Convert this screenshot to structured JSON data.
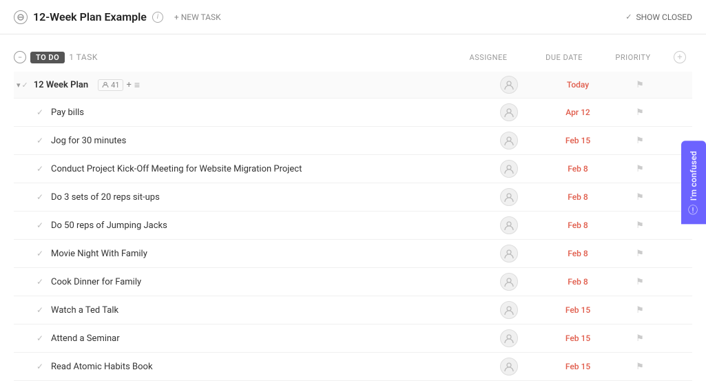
{
  "header": {
    "title": "12-Week Plan Example",
    "new_task_label": "+ NEW TASK",
    "show_closed_label": "SHOW CLOSED",
    "info_icon": "ⓘ"
  },
  "section": {
    "badge": "TO DO",
    "count_label": "1 TASK"
  },
  "columns": {
    "assignee": "ASSIGNEE",
    "due_date": "DUE DATE",
    "priority": "PRIORITY"
  },
  "parent_task": {
    "name": "12 Week Plan",
    "subtask_count": "41"
  },
  "tasks": [
    {
      "name": "Pay bills",
      "due": "Apr 12",
      "due_class": "due-red"
    },
    {
      "name": "Jog for 30 minutes",
      "due": "Feb 15",
      "due_class": "due-red"
    },
    {
      "name": "Conduct Project Kick-Off Meeting for Website Migration Project",
      "due": "Feb 8",
      "due_class": "due-red"
    },
    {
      "name": "Do 3 sets of 20 reps sit-ups",
      "due": "Feb 8",
      "due_class": "due-red"
    },
    {
      "name": "Do 50 reps of Jumping Jacks",
      "due": "Feb 8",
      "due_class": "due-red"
    },
    {
      "name": "Movie Night With Family",
      "due": "Feb 8",
      "due_class": "due-red"
    },
    {
      "name": "Cook Dinner for Family",
      "due": "Feb 8",
      "due_class": "due-red"
    },
    {
      "name": "Watch a Ted Talk",
      "due": "Feb 15",
      "due_class": "due-red"
    },
    {
      "name": "Attend a Seminar",
      "due": "Feb 15",
      "due_class": "due-red"
    },
    {
      "name": "Read Atomic Habits Book",
      "due": "Feb 15",
      "due_class": "due-red"
    }
  ],
  "feedback": {
    "label": "I'm confused",
    "icon": "ⓘ"
  }
}
